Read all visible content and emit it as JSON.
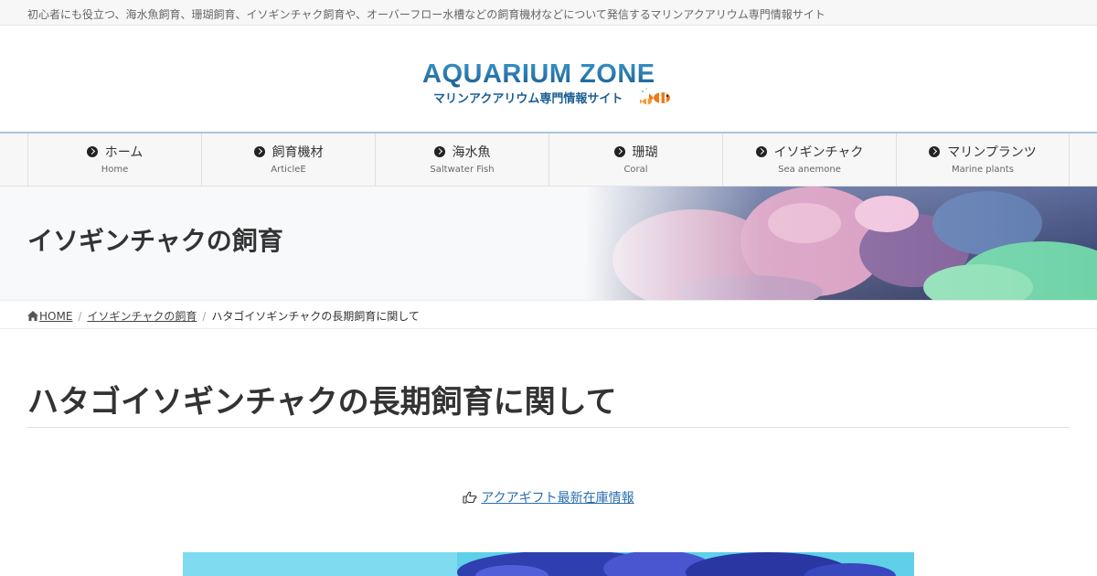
{
  "topbar": {
    "tagline": "初心者にも役立つ、海水魚飼育、珊瑚飼育、イソギンチャク飼育や、オーバーフロー水槽などの飼育機材などについて発信するマリンアクアリウム専門情報サイト"
  },
  "logo": {
    "title": "AQUARIUM ZONE",
    "subtitle": "マリンアクアリウム専門情報サイト"
  },
  "nav": {
    "items": [
      {
        "label": "ホーム",
        "sub": "Home"
      },
      {
        "label": "飼育機材",
        "sub": "ArticleE"
      },
      {
        "label": "海水魚",
        "sub": "Saltwater Fish"
      },
      {
        "label": "珊瑚",
        "sub": "Coral"
      },
      {
        "label": "イソギンチャク",
        "sub": "Sea anemone"
      },
      {
        "label": "マリンプランツ",
        "sub": "Marine plants"
      }
    ]
  },
  "hero": {
    "category_title": "イソギンチャクの飼育"
  },
  "breadcrumb": {
    "home": "HOME",
    "category": "イソギンチャクの飼育",
    "current": "ハタゴイソギンチャクの長期飼育に関して"
  },
  "post": {
    "title": "ハタゴイソギンチャクの長期飼育に関して",
    "promo_link": "アクアギフト最新在庫情報"
  },
  "icons": {
    "nav": "chevron-circle-right-icon",
    "breadcrumb_home": "home-icon",
    "promo": "hand-pointing-right-icon"
  },
  "colors": {
    "logo_blue": "#1b5f93",
    "link_blue": "#2a6fb0",
    "nav_border": "#a9c6e0"
  }
}
